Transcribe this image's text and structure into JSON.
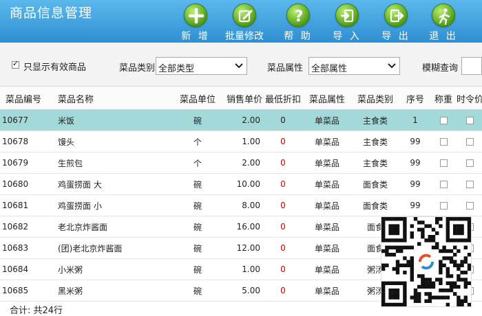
{
  "header": {
    "title": "商品信息管理",
    "toolbar": [
      {
        "id": "add",
        "label": "新 增",
        "icon": "plus-icon"
      },
      {
        "id": "batch",
        "label": "批量修改",
        "icon": "edit-icon"
      },
      {
        "id": "help",
        "label": "帮 助",
        "icon": "help-icon"
      },
      {
        "id": "import",
        "label": "导 入",
        "icon": "import-icon"
      },
      {
        "id": "export",
        "label": "导 出",
        "icon": "export-icon"
      },
      {
        "id": "exit",
        "label": "退 出",
        "icon": "exit-icon"
      }
    ]
  },
  "filters": {
    "only_valid_label": "只显示有效商品",
    "only_valid_checked": true,
    "category_label": "菜品类别",
    "category_value": "全部类型",
    "attribute_label": "菜品属性",
    "attribute_value": "全部属性",
    "fuzzy_label": "模糊查询",
    "fuzzy_value": ""
  },
  "table": {
    "headers": {
      "code": "菜品编号",
      "name": "菜品名称",
      "unit": "菜品单位",
      "price": "销售单价",
      "discount": "最低折扣",
      "attr": "菜品属性",
      "category": "菜品类别",
      "seq": "序号",
      "weigh": "称重",
      "seasonal": "时令价"
    },
    "rows": [
      {
        "code": "10677",
        "name": "米饭",
        "unit": "碗",
        "price": "2.00",
        "discount": "0",
        "attr": "单菜品",
        "category": "主食类",
        "seq": "1"
      },
      {
        "code": "10678",
        "name": "馒头",
        "unit": "个",
        "price": "1.00",
        "discount": "0",
        "attr": "单菜品",
        "category": "主食类",
        "seq": "99"
      },
      {
        "code": "10679",
        "name": "生煎包",
        "unit": "个",
        "price": "2.00",
        "discount": "0",
        "attr": "单菜品",
        "category": "主食类",
        "seq": "99"
      },
      {
        "code": "10680",
        "name": "鸡蛋捞面 大",
        "unit": "碗",
        "price": "10.00",
        "discount": "0",
        "attr": "单菜品",
        "category": "面食类",
        "seq": "99"
      },
      {
        "code": "10681",
        "name": "鸡蛋捞面 小",
        "unit": "碗",
        "price": "8.00",
        "discount": "0",
        "attr": "单菜品",
        "category": "面食类",
        "seq": "99"
      },
      {
        "code": "10682",
        "name": "老北京炸酱面",
        "unit": "碗",
        "price": "16.00",
        "discount": "0",
        "attr": "单菜品",
        "category": "面食",
        "seq": ""
      },
      {
        "code": "10683",
        "name": "(团)老北京炸酱面",
        "unit": "碗",
        "price": "12.00",
        "discount": "0",
        "attr": "单菜品",
        "category": "面食",
        "seq": ""
      },
      {
        "code": "10684",
        "name": "小米粥",
        "unit": "碗",
        "price": "1.00",
        "discount": "0",
        "attr": "单菜品",
        "category": "粥汤",
        "seq": ""
      },
      {
        "code": "10685",
        "name": "黑米粥",
        "unit": "碗",
        "price": "5.00",
        "discount": "0",
        "attr": "单菜品",
        "category": "粥汤",
        "seq": ""
      }
    ]
  },
  "footer": {
    "summary": "合计: 共24行"
  },
  "colors": {
    "header": "#2f8fd2",
    "selected_row": "#a3d9d9",
    "discount": "#d00000",
    "button": "#4e9c14"
  }
}
